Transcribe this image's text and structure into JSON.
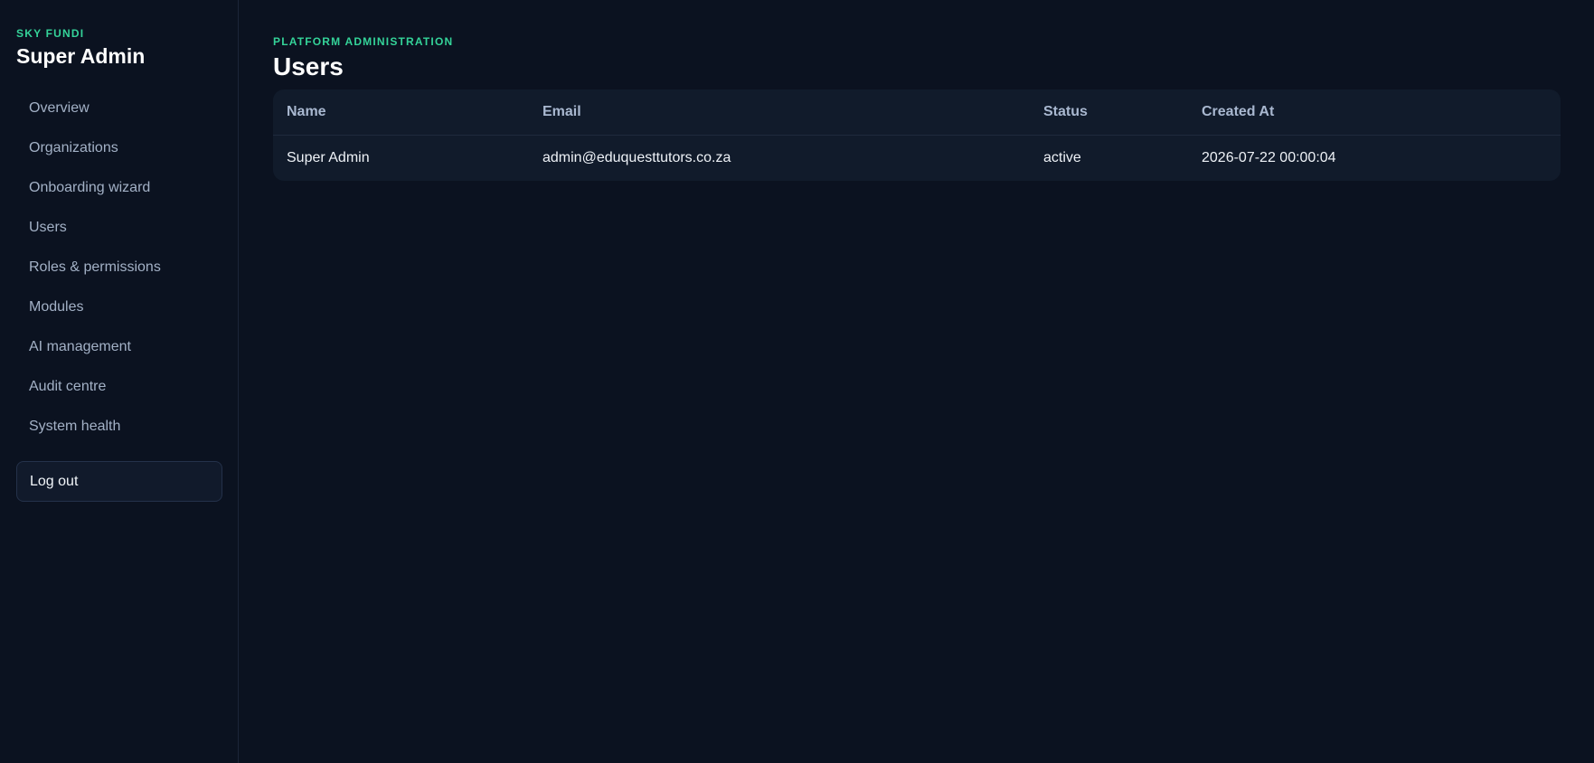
{
  "sidebar": {
    "brand_eyebrow": "SKY FUNDI",
    "brand_title": "Super Admin",
    "items": [
      {
        "label": "Overview"
      },
      {
        "label": "Organizations"
      },
      {
        "label": "Onboarding wizard"
      },
      {
        "label": "Users"
      },
      {
        "label": "Roles & permissions"
      },
      {
        "label": "Modules"
      },
      {
        "label": "AI management"
      },
      {
        "label": "Audit centre"
      },
      {
        "label": "System health"
      }
    ],
    "logout_label": "Log out"
  },
  "header": {
    "eyebrow": "PLATFORM ADMINISTRATION",
    "title": "Users"
  },
  "users_table": {
    "columns": [
      "Name",
      "Email",
      "Status",
      "Created At"
    ],
    "rows": [
      {
        "name": "Super Admin",
        "email": "admin@eduquesttutors.co.za",
        "status": "active",
        "created_at": "2026-07-22 00:00:04"
      }
    ]
  },
  "colors": {
    "background": "#0b1220",
    "accent": "#34d399",
    "card": "#111b2b"
  }
}
